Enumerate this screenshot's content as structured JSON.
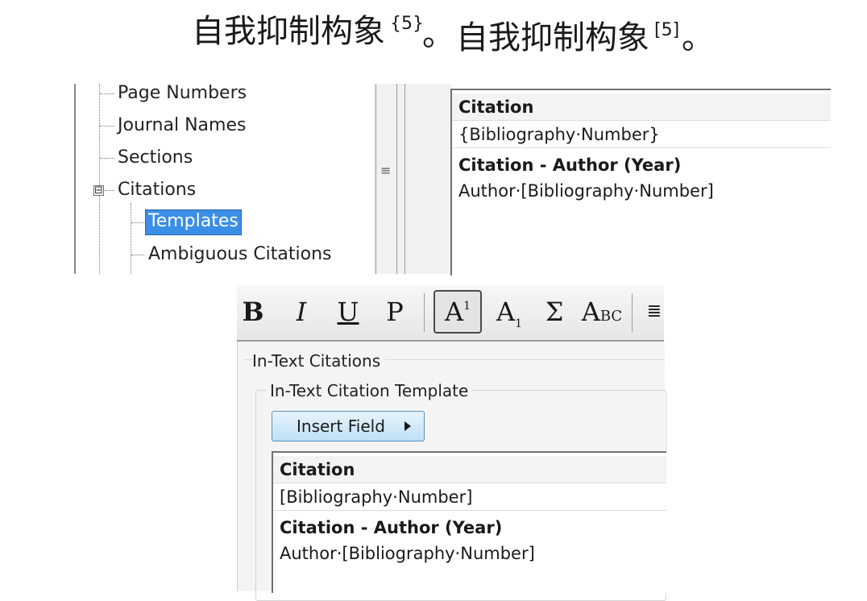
{
  "caption": {
    "left_text": "自我抑制构象",
    "left_sup": "{5}",
    "left_tail": "。",
    "right_text": "自我抑制构象",
    "right_sup": "[5]",
    "right_tail": "。"
  },
  "tree": {
    "items": [
      {
        "label": "Page Numbers"
      },
      {
        "label": "Journal Names"
      },
      {
        "label": "Sections"
      },
      {
        "label": "Citations",
        "expander": "⊟"
      },
      {
        "label": "Templates",
        "selected": true
      },
      {
        "label": "Ambiguous Citations"
      }
    ]
  },
  "splitter": {
    "grip": "≡"
  },
  "top_template": {
    "heading_1": "Citation",
    "value_1": "{Bibliography·Number}",
    "heading_2": "Citation - Author (Year)",
    "value_2": "Author·[Bibliography·Number]"
  },
  "toolbar": {
    "bold": "B",
    "italic": "I",
    "underline": "U",
    "plain": "P",
    "superscript": "A",
    "superscript_mark": "1",
    "subscript": "A",
    "subscript_mark": "1",
    "symbol": "Σ",
    "smallcaps": "A",
    "smallcaps_mark": "BC",
    "justify": "≣"
  },
  "dialog": {
    "section_title": "In-Text Citations",
    "group_title": "In-Text Citation Template",
    "insert_field": "Insert Field",
    "template": {
      "heading_1": "Citation",
      "value_1": "[Bibliography·Number]",
      "heading_2": "Citation - Author (Year)",
      "value_2": "Author·[Bibliography·Number]"
    }
  },
  "colors": {
    "selection": "#3a8ee6",
    "insert_button": "#bfe0f6"
  }
}
